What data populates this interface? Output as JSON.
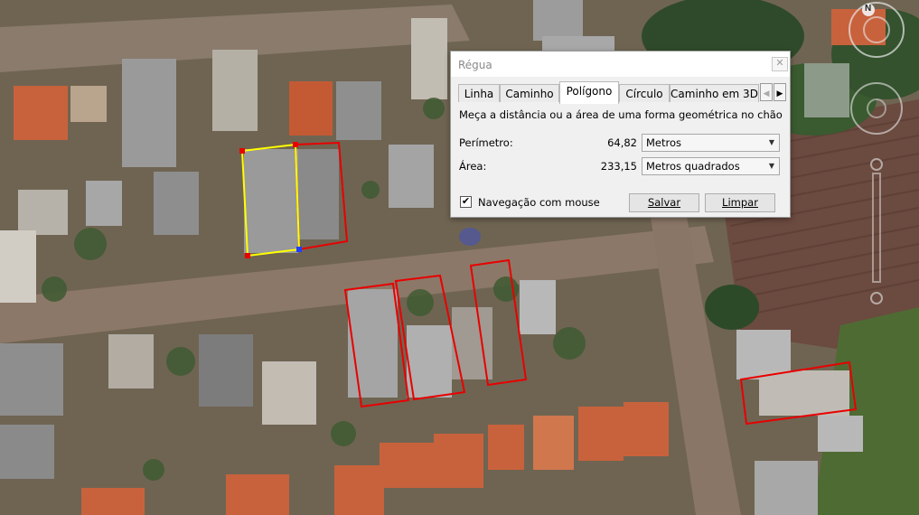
{
  "dialog": {
    "title": "Régua",
    "close_icon": "close-icon",
    "tabs": [
      {
        "label": "Linha"
      },
      {
        "label": "Caminho"
      },
      {
        "label": "Polígono",
        "active": true
      },
      {
        "label": "Círculo"
      },
      {
        "label": "Caminho em 3D"
      }
    ],
    "tab_scroll": {
      "left_icon": "chevron-left-icon",
      "right_icon": "chevron-right-icon"
    },
    "description": "Meça a distância ou a área de uma forma geométrica no chão",
    "perimeter": {
      "label": "Perímetro:",
      "value": "64,82",
      "unit": "Metros"
    },
    "area": {
      "label": "Área:",
      "value": "233,15",
      "unit": "Metros quadrados"
    },
    "mouse_nav": {
      "label": "Navegação com mouse",
      "checked": true
    },
    "save_label": "Salvar",
    "clear_label": "Limpar"
  },
  "map": {
    "compass_label": "N",
    "measured_polygon_color": "#ffff00",
    "highlight_color": "#ff0000"
  }
}
